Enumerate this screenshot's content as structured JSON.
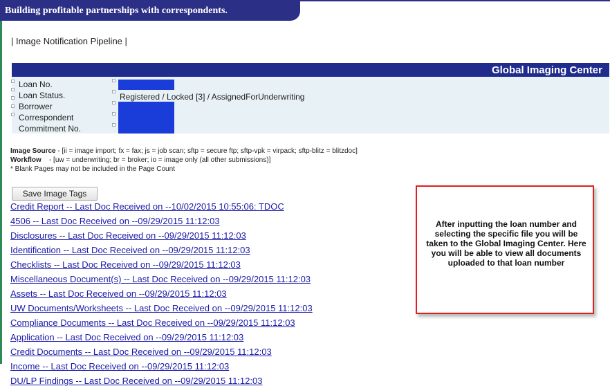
{
  "banner": {
    "title": "Building profitable partnerships with correspondents."
  },
  "nav": {
    "text": "| Image Notification Pipeline |"
  },
  "gic": {
    "title": "Global Imaging Center"
  },
  "info": {
    "labels": [
      "Loan No.",
      "Loan Status.",
      "Borrower",
      "Correspondent",
      "Commitment No."
    ],
    "loan_status_value": "Registered / Locked [3] / AssignedForUnderwriting",
    "redaction_color": "#1a3cd8"
  },
  "legend": {
    "source_label": "Image Source",
    "source_text": " - [ii = image import; fx = fax; js = job scan; sftp = secure ftp; sftp-vpk = virpack; sftp-blitz = blitzdoc]",
    "workflow_label": "Workflow",
    "workflow_text": "    - [uw = underwriting; br = broker; io = image only (all other submissions)]",
    "note": "* Blank Pages may not be included in the Page Count"
  },
  "toolbar": {
    "save_label": "Save Image Tags"
  },
  "documents": [
    "Credit Report -- Last Doc Received on --10/02/2015 10:55:06: TDOC",
    "4506 -- Last Doc Received on --09/29/2015 11:12:03",
    "Disclosures -- Last Doc Received on --09/29/2015 11:12:03",
    "Identification -- Last Doc Received on --09/29/2015 11:12:03",
    "Checklists -- Last Doc Received on --09/29/2015 11:12:03",
    "Miscellaneous Document(s) -- Last Doc Received on --09/29/2015 11:12:03",
    "Assets -- Last Doc Received on --09/29/2015 11:12:03",
    "UW Documents/Worksheets -- Last Doc Received on --09/29/2015 11:12:03",
    "Compliance Documents -- Last Doc Received on --09/29/2015 11:12:03",
    "Application -- Last Doc Received on --09/29/2015 11:12:03",
    "Credit Documents -- Last Doc Received on --09/29/2015 11:12:03",
    "Income -- Last Doc Received on --09/29/2015 11:12:03",
    "DU/LP Findings -- Last Doc Received on --09/29/2015 11:12:03"
  ],
  "callout": {
    "text": "After inputting the loan number and selecting the specific file you will be taken to the Global Imaging Center. Here you will be able to view all documents uploaded to that loan number",
    "border_color": "#e0201c"
  },
  "colors": {
    "header_navy": "#1f2c8c",
    "link_blue": "#1a1aa8",
    "panel_bg": "#e8f1f5"
  }
}
